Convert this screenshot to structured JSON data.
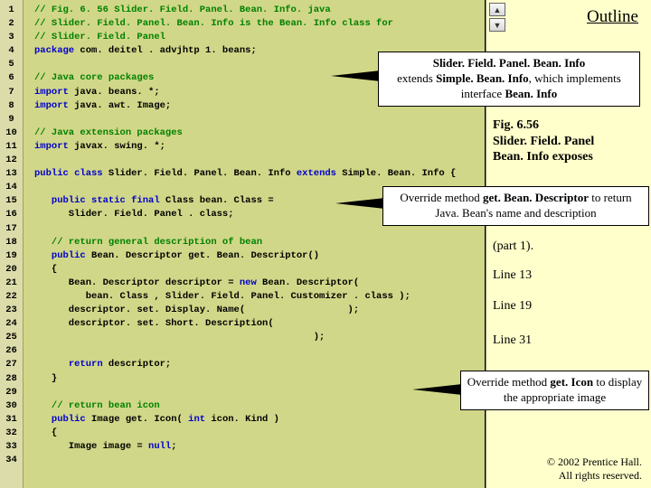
{
  "outline_label": "Outline",
  "lines": [
    {
      "type": "c",
      "text": "// Fig. 6. 56 Slider. Field. Panel. Bean. Info. java"
    },
    {
      "type": "c",
      "text": "// Slider. Field. Panel. Bean. Info is the Bean. Info class for"
    },
    {
      "type": "c",
      "text": "// Slider. Field. Panel"
    },
    {
      "html": "<span class='kw'>package</span> com. deitel . advjhtp 1. beans;"
    },
    {
      "text": ""
    },
    {
      "type": "c",
      "text": "// Java core packages"
    },
    {
      "html": "<span class='kw'>import</span> java. beans. *;"
    },
    {
      "html": "<span class='kw'>import</span> java. awt. Image;"
    },
    {
      "text": ""
    },
    {
      "type": "c",
      "text": "// Java extension packages"
    },
    {
      "html": "<span class='kw'>import</span> javax. swing. *;"
    },
    {
      "text": ""
    },
    {
      "html": "<span class='kw'>public class</span> Slider. Field. Panel. Bean. Info <span class='kw'>extends</span> Simple. Bean. Info {"
    },
    {
      "text": ""
    },
    {
      "html": "   <span class='kw'>public static final</span> Class bean. Class ="
    },
    {
      "text": "      Slider. Field. Panel . class;"
    },
    {
      "text": ""
    },
    {
      "type": "c",
      "text": "   // return general description of bean"
    },
    {
      "html": "   <span class='kw'>public</span> Bean. Descriptor get. Bean. Descriptor()"
    },
    {
      "text": "   {"
    },
    {
      "html": "      Bean. Descriptor descriptor = <span class='kw'>new</span> Bean. Descriptor("
    },
    {
      "text": "         bean. Class , Slider. Field. Panel. Customizer . class );"
    },
    {
      "text": "      descriptor. set. Display. Name(                  );"
    },
    {
      "text": "      descriptor. set. Short. Description("
    },
    {
      "text": "                                                 );"
    },
    {
      "text": ""
    },
    {
      "html": "      <span class='kw'>return</span> descriptor;"
    },
    {
      "text": "   }"
    },
    {
      "text": ""
    },
    {
      "type": "c",
      "text": "   // return bean icon"
    },
    {
      "html": "   <span class='kw'>public</span> Image get. Icon( <span class='kw'>int</span> icon. Kind )"
    },
    {
      "text": "   {"
    },
    {
      "html": "      Image image = <span class='kw'>null</span>;"
    },
    {
      "text": ""
    }
  ],
  "callouts": {
    "co1": "<b>Slider. Field. Panel. Bean. Info</b><br>extends <b>Simple. Bean. Info</b>, which implements interface <b>Bean. Info</b>",
    "co2": "Override method <b>get. Bean. Descriptor</b> to return Java. Bean's name and description",
    "co3": "Override method <b>get. Icon</b> to display the appropriate image"
  },
  "notes": {
    "fig": "Fig. 6.56<br><b>Slider. Field. Panel</b><br><b>Bean. Info</b> exposes",
    "pt": "(part 1).",
    "l13": "Line 13",
    "l19": "Line 19",
    "l31": "Line 31"
  },
  "copyright": "© 2002 Prentice Hall.<br>All rights reserved.",
  "nav": {
    "up": "▲",
    "down": "▼"
  }
}
